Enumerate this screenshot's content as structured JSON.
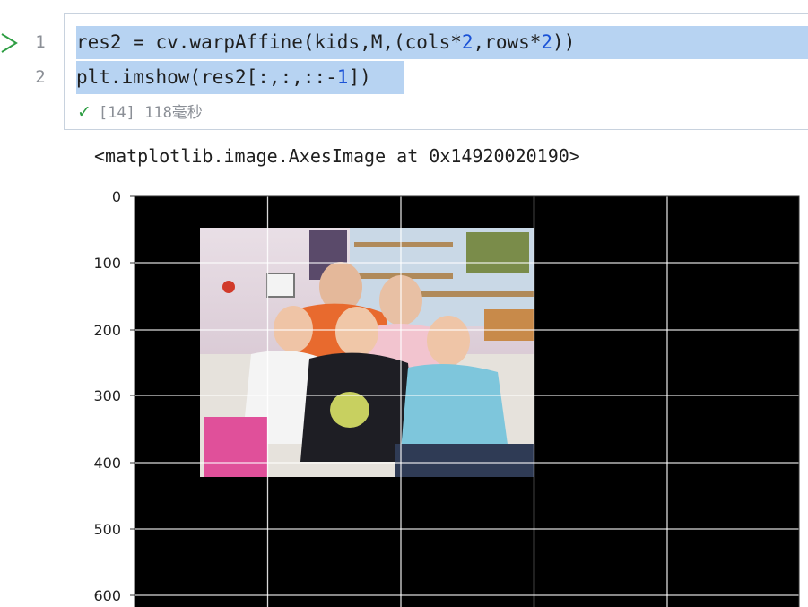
{
  "cell": {
    "line_numbers": [
      "1",
      "2"
    ],
    "code": {
      "line1": {
        "p1": "res2 = cv.warpAffine(kids,M,(cols*",
        "n1": "2",
        "p2": ",rows*",
        "n2": "2",
        "p3": "))"
      },
      "line2": {
        "p1": "plt.imshow(res2[:,:,::-",
        "n1": "1",
        "p2": "])"
      }
    },
    "status": {
      "icon": "check-icon",
      "text": "[14] 118毫秒"
    }
  },
  "output": {
    "repr_text": "<matplotlib.image.AxesImage at 0x14920020190>",
    "axes": {
      "y_ticks": [
        "0",
        "100",
        "200",
        "300",
        "400",
        "500",
        "600"
      ],
      "grid": true,
      "background": "#000000",
      "image_description": "family photo placed in top-left quarter of black canvas"
    }
  },
  "colors": {
    "selection": "#b7d3f2",
    "number": "#1a52d6",
    "status_check": "#2f9e44",
    "run_arrow": "#2f9e44",
    "cell_border": "#c8d2de"
  }
}
